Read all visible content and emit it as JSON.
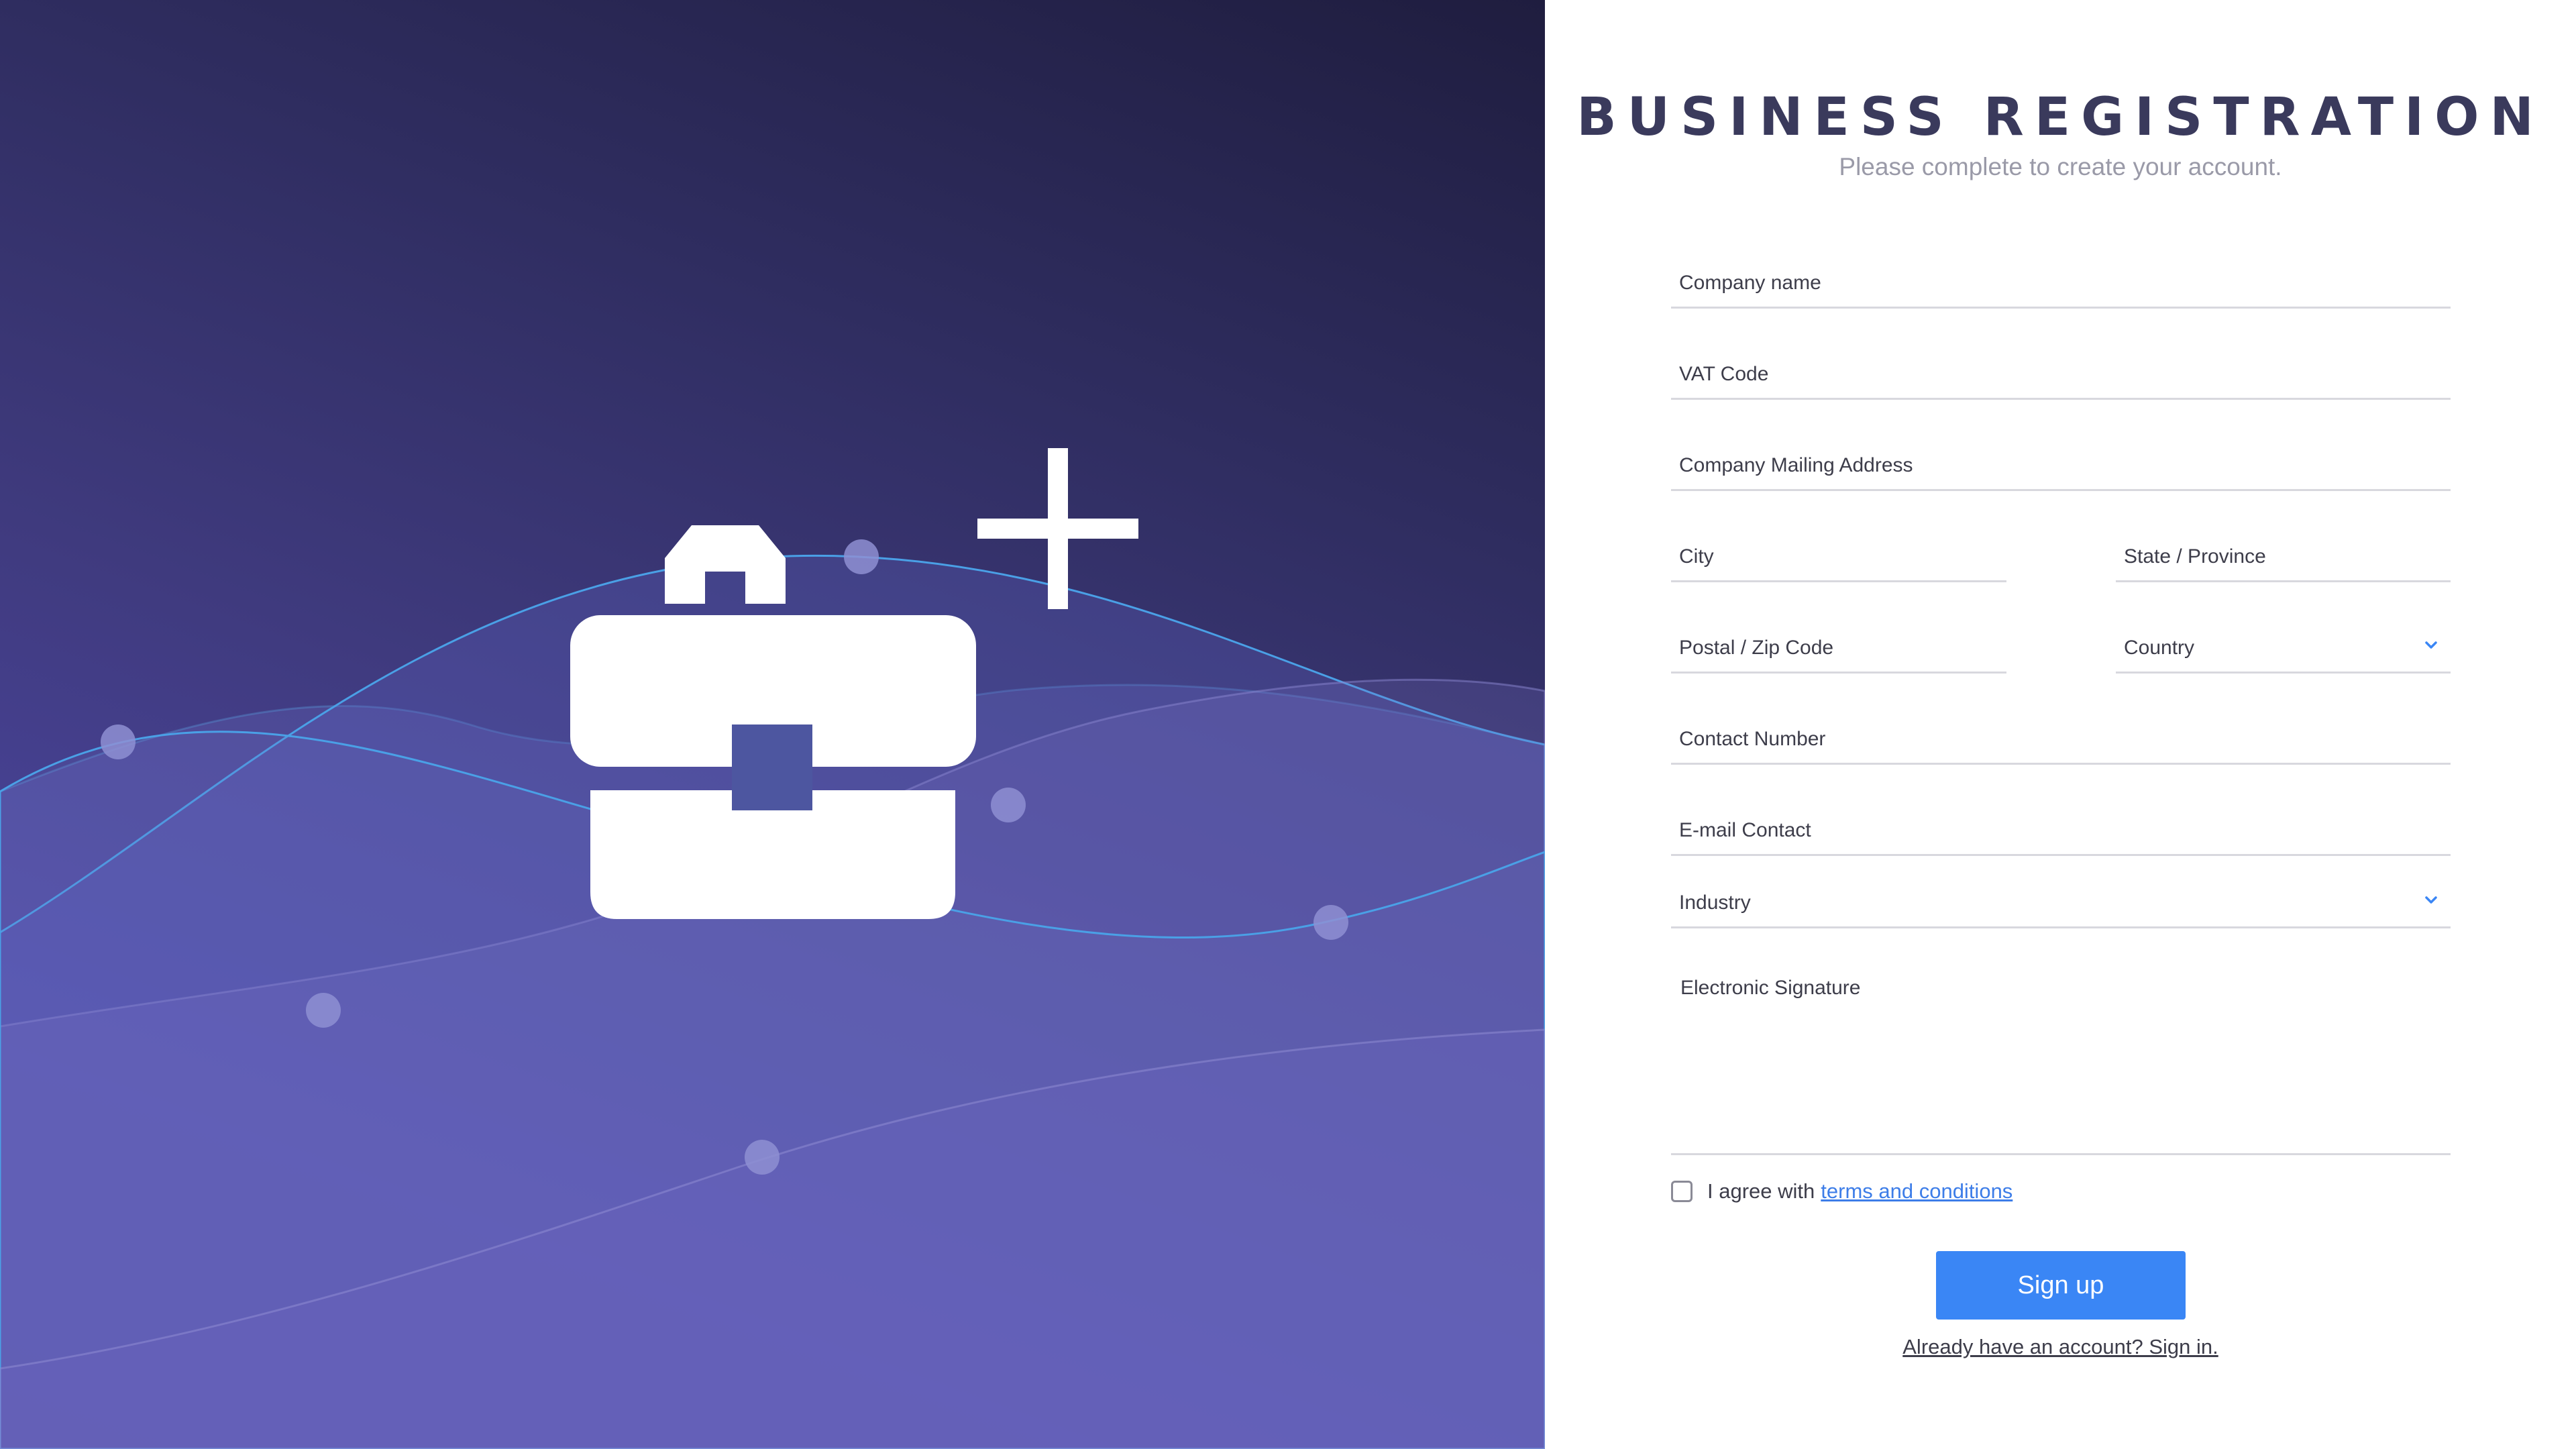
{
  "hero": {
    "illustration": "briefcase-plus-icon",
    "gradient_colors": [
      "#1f1d3f",
      "#2f2d60",
      "#403b80",
      "#4b45a0"
    ]
  },
  "form": {
    "title": "BUSINESS REGISTRATION",
    "subtitle": "Please complete to create your account.",
    "fields": {
      "company_name": "Company name",
      "vat_code": "VAT Code",
      "mailing_address": "Company Mailing Address",
      "city": "City",
      "state": "State / Province",
      "postal": "Postal / Zip Code",
      "country": "Country",
      "contact_number": "Contact Number",
      "email": "E-mail Contact",
      "industry": "Industry",
      "signature": "Electronic Signature"
    },
    "agree_text": "I agree with",
    "terms_link": "terms and conditions",
    "signup_label": "Sign up",
    "signin_link": "Already have an account? Sign in."
  },
  "colors": {
    "accent": "#3a86f5",
    "link": "#3d7de8",
    "title": "#3a3a5c",
    "subtitle": "#9a9aa8"
  }
}
